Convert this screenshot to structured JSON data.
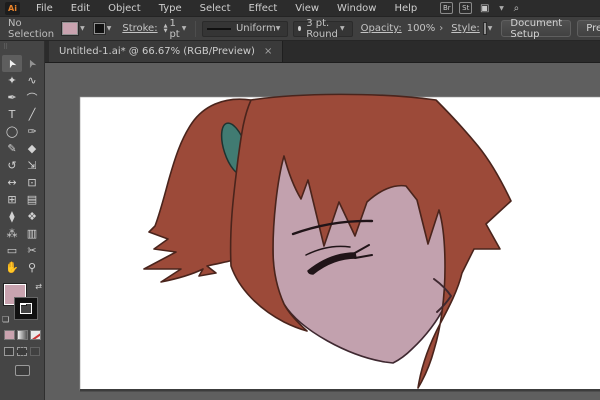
{
  "menubar": {
    "logo": "Ai",
    "items": [
      "File",
      "Edit",
      "Object",
      "Type",
      "Select",
      "Effect",
      "View",
      "Window",
      "Help"
    ],
    "right_icons": [
      {
        "name": "bridge-icon",
        "label": "Br"
      },
      {
        "name": "stock-icon",
        "label": "St"
      },
      {
        "name": "workspace-switcher-icon",
        "label": "▣",
        "chevron": "▼"
      },
      {
        "name": "search-icon",
        "label": "⌕"
      }
    ]
  },
  "controlbar": {
    "selection_status": "No Selection",
    "fill_swatch_color": "#c9a3af",
    "stroke_swatch_color": "#111111",
    "stroke_label": "Stroke:",
    "stroke_width": "1 pt",
    "profile_value": "Uniform",
    "brush_value": "3 pt. Round",
    "opacity_label": "Opacity:",
    "opacity_value": "100%",
    "style_label": "Style:",
    "document_setup_label": "Document Setup",
    "preferences_label": "Preferences",
    "chevron": "▼",
    "stepper_up": "▲",
    "stepper_down": "▼",
    "opacity_chevron": "›"
  },
  "tab": {
    "title": "Untitled-1.ai* @ 66.67% (RGB/Preview)",
    "close": "×"
  },
  "toolbar": {
    "grip": "⠿",
    "tools": [
      {
        "name": "selection-tool",
        "glyph": "➤",
        "active": true,
        "rot": -115
      },
      {
        "name": "direct-selection-tool",
        "glyph": "➤",
        "rot": -115,
        "hollow": true
      },
      {
        "name": "magic-wand-tool",
        "glyph": "✦"
      },
      {
        "name": "lasso-tool",
        "glyph": "∿"
      },
      {
        "name": "pen-tool",
        "glyph": "✒"
      },
      {
        "name": "curvature-tool",
        "glyph": "⌒"
      },
      {
        "name": "type-tool",
        "glyph": "T"
      },
      {
        "name": "line-segment-tool",
        "glyph": "╱"
      },
      {
        "name": "ellipse-tool",
        "glyph": "◯"
      },
      {
        "name": "paintbrush-tool",
        "glyph": "✑"
      },
      {
        "name": "pencil-tool",
        "glyph": "✎"
      },
      {
        "name": "blob-brush-tool",
        "glyph": "◆"
      },
      {
        "name": "rotate-tool",
        "glyph": "↺"
      },
      {
        "name": "scale-tool",
        "glyph": "⇲"
      },
      {
        "name": "width-tool",
        "glyph": "↔"
      },
      {
        "name": "free-transform-tool",
        "glyph": "⊡"
      },
      {
        "name": "mesh-tool",
        "glyph": "⊞"
      },
      {
        "name": "gradient-tool",
        "glyph": "▤"
      },
      {
        "name": "eyedropper-tool",
        "glyph": "⧫"
      },
      {
        "name": "blend-tool",
        "glyph": "❖"
      },
      {
        "name": "symbol-sprayer-tool",
        "glyph": "⁂"
      },
      {
        "name": "column-graph-tool",
        "glyph": "▥"
      },
      {
        "name": "artboard-tool",
        "glyph": "▭"
      },
      {
        "name": "slice-tool",
        "glyph": "✂"
      },
      {
        "name": "hand-tool",
        "glyph": "✋"
      },
      {
        "name": "zoom-tool",
        "glyph": "⚲"
      }
    ],
    "swap_icon": "⇄",
    "default_swatches_icon": "❏"
  },
  "artwork": {
    "description": "anime-style head with auburn side ponytail, teal hair tie, closed eye, drawn on white artboard",
    "colors": {
      "pasteboard": "#5f5f5f",
      "artboard": "#ffffff",
      "hair": "#9c4a39",
      "hair_outline": "#4a241c",
      "skin": "#c2a1ae",
      "skin_outline": "#3e2830",
      "tie": "#417b72",
      "tie_outline": "#1e3330",
      "line": "#201418"
    }
  }
}
